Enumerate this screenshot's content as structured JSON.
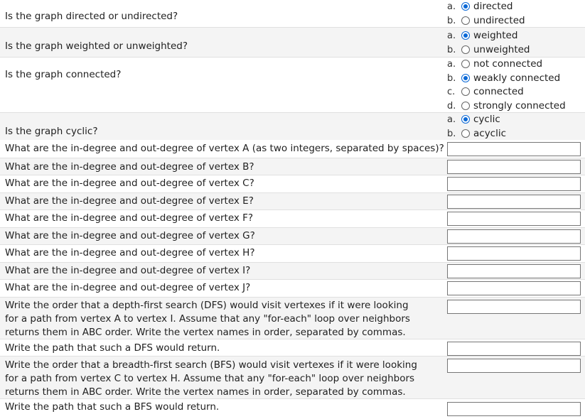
{
  "radio_questions": [
    {
      "question": "Is the graph directed or undirected?",
      "options": [
        {
          "letter": "a.",
          "label": "directed",
          "selected": true
        },
        {
          "letter": "b.",
          "label": "undirected",
          "selected": false
        }
      ]
    },
    {
      "question": "Is the graph weighted or unweighted?",
      "options": [
        {
          "letter": "a.",
          "label": "weighted",
          "selected": true
        },
        {
          "letter": "b.",
          "label": "unweighted",
          "selected": false
        }
      ]
    },
    {
      "question": "Is the graph connected?",
      "options": [
        {
          "letter": "a.",
          "label": "not connected",
          "selected": false
        },
        {
          "letter": "b.",
          "label": "weakly connected",
          "selected": true
        },
        {
          "letter": "c.",
          "label": "connected",
          "selected": false
        },
        {
          "letter": "d.",
          "label": "strongly connected",
          "selected": false
        }
      ]
    },
    {
      "question": "Is the graph cyclic?",
      "options": [
        {
          "letter": "a.",
          "label": "cyclic",
          "selected": true
        },
        {
          "letter": "b.",
          "label": "acyclic",
          "selected": false
        }
      ]
    }
  ],
  "degree_questions": [
    "What are the in-degree and out-degree of vertex A (as two integers, separated by spaces)?",
    "What are the in-degree and out-degree of vertex B?",
    "What are the in-degree and out-degree of vertex C?",
    "What are the in-degree and out-degree of vertex E?",
    "What are the in-degree and out-degree of vertex F?",
    "What are the in-degree and out-degree of vertex G?",
    "What are the in-degree and out-degree of vertex H?",
    "What are the in-degree and out-degree of vertex I?",
    "What are the in-degree and out-degree of vertex J?"
  ],
  "dfs": {
    "order_question": "Write the order that a depth-first search (DFS) would visit vertexes if it were looking for a path from vertex A to vertex I. Assume that any \"for-each\" loop over neighbors returns them in ABC order. Write the vertex names in order, separated by commas.",
    "path_question": "Write the path that such a DFS would return."
  },
  "bfs": {
    "order_question": "Write the order that a breadth-first search (BFS) would visit vertexes if it were looking for a path from vertex C to vertex H. Assume that any \"for-each\" loop over neighbors returns them in ABC order. Write the vertex names in order, separated by commas.",
    "path_question": "Write the path that such a BFS would return."
  },
  "answers": {
    "degree_values": [
      "",
      "",
      "",
      "",
      "",
      "",
      "",
      "",
      ""
    ],
    "dfs_order": "",
    "dfs_path": "",
    "bfs_order": "",
    "bfs_path": ""
  }
}
